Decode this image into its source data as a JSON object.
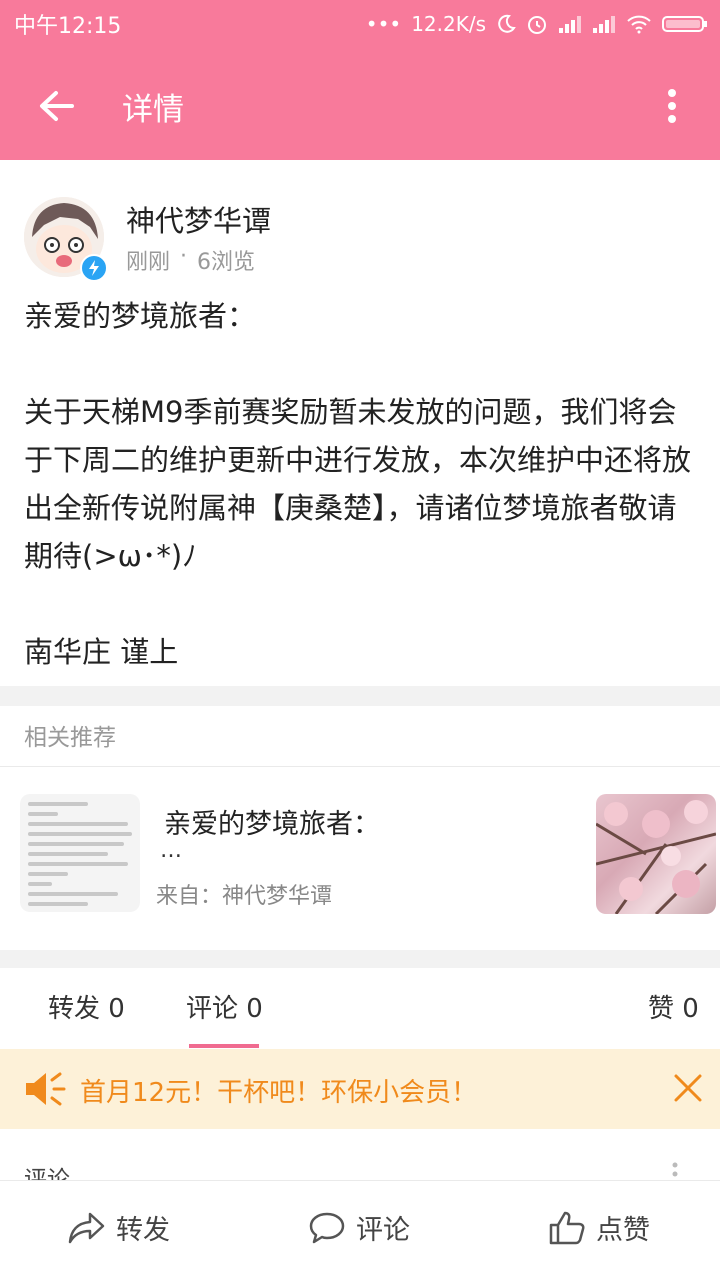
{
  "status": {
    "time": "中午12:15",
    "speed": "12.2K/s"
  },
  "toolbar": {
    "title": "详情",
    "back_icon": "arrow-left-icon",
    "more_icon": "more-vertical-icon"
  },
  "post": {
    "author": "神代梦华谭",
    "time": "刚刚",
    "dot": "·",
    "views": "6浏览",
    "body": [
      "亲爱的梦境旅者：",
      "",
      "关于天梯M9季前赛奖励暂未发放的问题，我们将会于下周二的维护更新中进行发放，本次维护中还将放出全新传说附属神【庚桑楚】，请诸位梦境旅者敬请期待(>ω･*)ﾉ",
      "",
      "南华庄 谨上"
    ]
  },
  "related": {
    "title": "相关推荐",
    "item": {
      "title": "亲爱的梦境旅者：",
      "dots": "…",
      "source": "来自：神代梦华谭"
    }
  },
  "tabs": {
    "repost": "转发 0",
    "comment": "评论 0",
    "like": "赞 0"
  },
  "banner": {
    "text": "首月12元！干杯吧！环保小会员！"
  },
  "comments": {
    "label": "评论"
  },
  "bottom_bar": {
    "repost": "转发",
    "comment": "评论",
    "like": "点赞"
  },
  "colors": {
    "accent": "#f87a9b",
    "tab_indicator": "#f06b90",
    "banner_bg": "#fdf1d8",
    "banner_text": "#f08a1c"
  }
}
